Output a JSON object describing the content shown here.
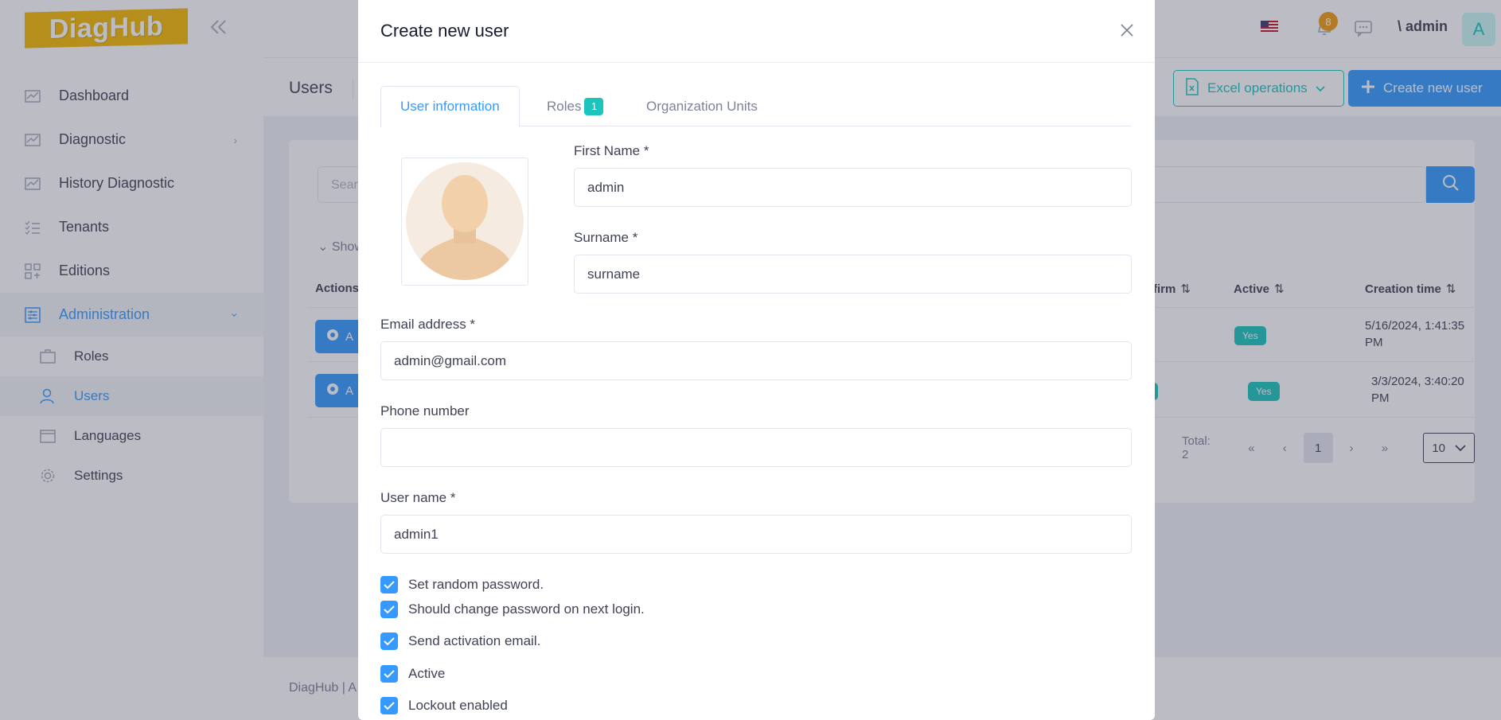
{
  "app": {
    "logo_text": "DiagHub"
  },
  "sidebar": {
    "items": [
      {
        "label": "Dashboard",
        "icon": "chart-icon"
      },
      {
        "label": "Diagnostic",
        "icon": "chart-icon",
        "has_children": true
      },
      {
        "label": "History Diagnostic",
        "icon": "chart-icon"
      },
      {
        "label": "Tenants",
        "icon": "list-icon"
      },
      {
        "label": "Editions",
        "icon": "grid-icon"
      },
      {
        "label": "Administration",
        "icon": "sliders-icon",
        "expanded": true,
        "active": true
      }
    ],
    "sub_items": [
      {
        "label": "Roles",
        "icon": "briefcase-icon"
      },
      {
        "label": "Users",
        "icon": "users-icon",
        "active": true
      },
      {
        "label": "Languages",
        "icon": "window-icon"
      },
      {
        "label": "Settings",
        "icon": "gear-icon"
      }
    ]
  },
  "header": {
    "notification_count": "8",
    "user_label": "\\ admin",
    "avatar_letter": "A"
  },
  "subheader": {
    "title": "Users",
    "excel_label": "Excel operations",
    "create_label": "Create new user"
  },
  "content": {
    "search_placeholder": "Sear",
    "show_advanced": "Show",
    "columns": {
      "actions": "Actions",
      "confirm": "firm",
      "active": "Active",
      "creation_time": "Creation time"
    },
    "rows": [
      {
        "action_label": "A",
        "active": "Yes",
        "creation_time": "5/16/2024, 1:41:35 PM"
      },
      {
        "action_label": "A",
        "active": "Yes",
        "creation_time": "3/3/2024, 3:40:20 PM"
      }
    ],
    "pager": {
      "total": "Total: 2",
      "current_page": "1",
      "page_size": "10"
    }
  },
  "footer": {
    "text": "DiagHub | A"
  },
  "modal": {
    "title": "Create new user",
    "tabs": [
      {
        "label": "User information",
        "active": true
      },
      {
        "label": "Roles",
        "badge": "1"
      },
      {
        "label": "Organization Units"
      }
    ],
    "fields": {
      "first_name": {
        "label": "First Name *",
        "value": "admin"
      },
      "surname": {
        "label": "Surname *",
        "value": "surname"
      },
      "email": {
        "label": "Email address *",
        "value": "admin@gmail.com"
      },
      "phone": {
        "label": "Phone number",
        "value": ""
      },
      "username": {
        "label": "User name *",
        "value": "admin1"
      }
    },
    "checkboxes": [
      {
        "label": "Set random password.",
        "checked": true
      },
      {
        "label": "Should change password on next login.",
        "checked": true
      },
      {
        "label": "Send activation email.",
        "checked": true
      },
      {
        "label": "Active",
        "checked": true
      },
      {
        "label": "Lockout enabled",
        "checked": true
      }
    ]
  },
  "colors": {
    "primary": "#3699ff",
    "success": "#1bc5bd",
    "brand": "#f6b800",
    "warning": "#f39c12"
  }
}
